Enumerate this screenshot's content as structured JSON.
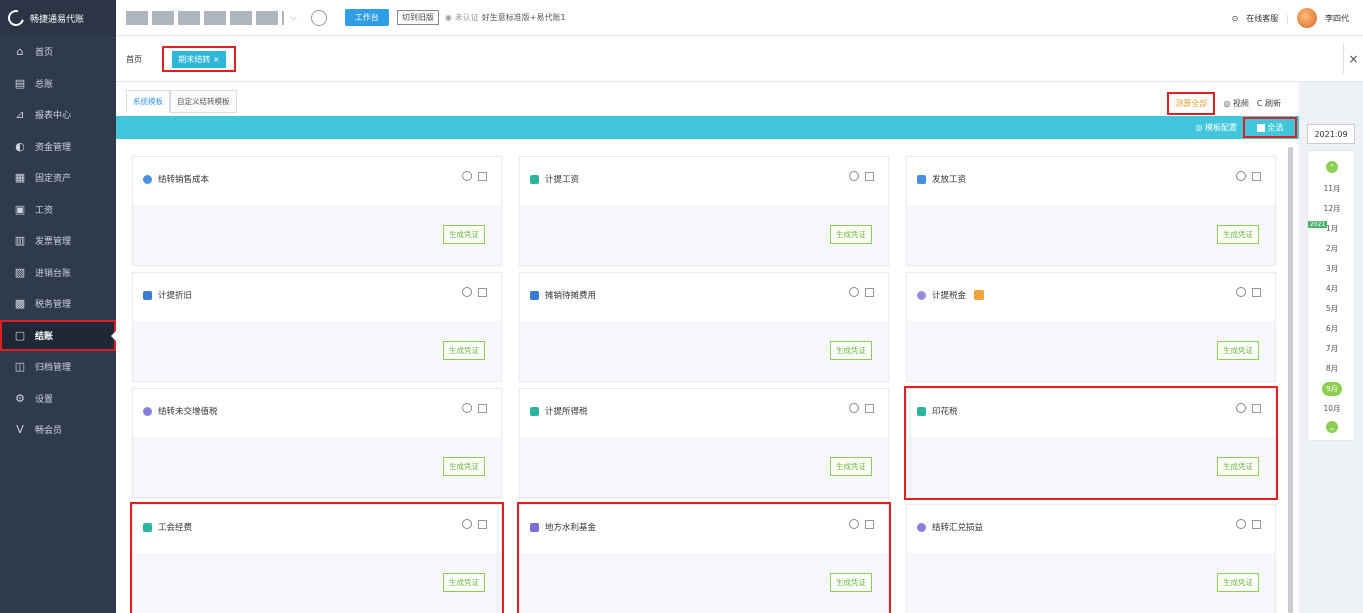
{
  "app": {
    "logo_text": "畅捷通易代账"
  },
  "sidebar": {
    "items": [
      {
        "label": "首页",
        "icon": "home-icon",
        "glyph": "⌂"
      },
      {
        "label": "总账",
        "icon": "ledger-icon",
        "glyph": "▤"
      },
      {
        "label": "报表中心",
        "icon": "chart-icon",
        "glyph": "⊿"
      },
      {
        "label": "资金管理",
        "icon": "wallet-icon",
        "glyph": "◐"
      },
      {
        "label": "固定资产",
        "icon": "building-icon",
        "glyph": "▦"
      },
      {
        "label": "工资",
        "icon": "salary-icon",
        "glyph": "▣"
      },
      {
        "label": "发票管理",
        "icon": "invoice-icon",
        "glyph": "▥"
      },
      {
        "label": "进销台账",
        "icon": "inventory-icon",
        "glyph": "▧"
      },
      {
        "label": "税务管理",
        "icon": "tax-icon",
        "glyph": "▩"
      },
      {
        "label": "结账",
        "icon": "checkout-icon",
        "glyph": "▢"
      },
      {
        "label": "归档管理",
        "icon": "archive-icon",
        "glyph": "◫"
      },
      {
        "label": "设置",
        "icon": "gear-icon",
        "glyph": "⚙"
      },
      {
        "label": "畅会员",
        "icon": "member-icon",
        "glyph": "V"
      }
    ]
  },
  "topbar": {
    "work_label": "工作台",
    "switch_label": "切到旧版",
    "verify_status": "未认证",
    "plan_text": "好生意标准版+易代账1",
    "service_label": "在线客服",
    "user_name": "李四代"
  },
  "tabs": {
    "home": "首页",
    "active": "期末结转 ×",
    "close_all": "×"
  },
  "content": {
    "subtabs": [
      "系统模板",
      "自定义结转模板"
    ],
    "measure_all": "测算全部",
    "video": "◎ 视频",
    "refresh": "C 刷新",
    "template_config": "◎ 模板配置",
    "select_all": "全选",
    "generate_label": "生成凭证",
    "cards": [
      {
        "title": "结转销售成本",
        "color": "#4a90e2",
        "round": true
      },
      {
        "title": "计提工资",
        "color": "#2cb6a0",
        "round": false
      },
      {
        "title": "发放工资",
        "color": "#4a90e2",
        "round": false
      },
      {
        "title": "计提折旧",
        "color": "#3a7bd5",
        "round": false
      },
      {
        "title": "摊销待摊费用",
        "color": "#3a7bd5",
        "round": false
      },
      {
        "title": "计提税金",
        "color": "#9b8ce0",
        "round": true,
        "badge": true
      },
      {
        "title": "结转未交增值税",
        "color": "#8a7ee0",
        "round": true
      },
      {
        "title": "计提所得税",
        "color": "#2cb6a0",
        "round": false
      },
      {
        "title": "印花税",
        "color": "#2cb6a0",
        "round": false
      },
      {
        "title": "工会经费",
        "color": "#2cb6a0",
        "round": false
      },
      {
        "title": "地方水利基金",
        "color": "#7a6fd6",
        "round": false
      },
      {
        "title": "结转汇兑损益",
        "color": "#8a7ee0",
        "round": true
      }
    ]
  },
  "month_rail": {
    "period": "2021.09",
    "year_tag": "2021",
    "months": [
      "11月",
      "12月",
      "1月",
      "2月",
      "3月",
      "4月",
      "5月",
      "6月",
      "7月",
      "8月",
      "10月"
    ],
    "current": "9月",
    "up_glyph": "⌃",
    "down_glyph": "⌄"
  },
  "colors": {
    "sidebar": "#2f3a4c",
    "accent": "#2f9ee6",
    "teal": "#41c6dc",
    "highlight": "#e02020",
    "green": "#8ccf52"
  }
}
